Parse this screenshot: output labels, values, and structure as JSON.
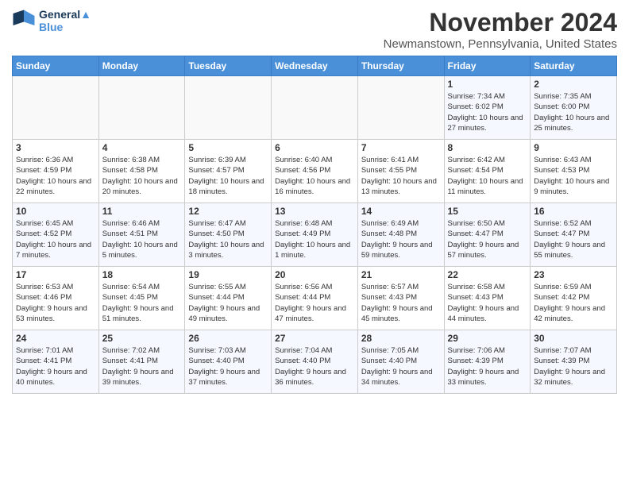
{
  "logo": {
    "line1": "General",
    "line2": "Blue"
  },
  "title": "November 2024",
  "subtitle": "Newmanstown, Pennsylvania, United States",
  "days_of_week": [
    "Sunday",
    "Monday",
    "Tuesday",
    "Wednesday",
    "Thursday",
    "Friday",
    "Saturday"
  ],
  "weeks": [
    [
      {
        "day": "",
        "info": ""
      },
      {
        "day": "",
        "info": ""
      },
      {
        "day": "",
        "info": ""
      },
      {
        "day": "",
        "info": ""
      },
      {
        "day": "",
        "info": ""
      },
      {
        "day": "1",
        "info": "Sunrise: 7:34 AM\nSunset: 6:02 PM\nDaylight: 10 hours and 27 minutes."
      },
      {
        "day": "2",
        "info": "Sunrise: 7:35 AM\nSunset: 6:00 PM\nDaylight: 10 hours and 25 minutes."
      }
    ],
    [
      {
        "day": "3",
        "info": "Sunrise: 6:36 AM\nSunset: 4:59 PM\nDaylight: 10 hours and 22 minutes."
      },
      {
        "day": "4",
        "info": "Sunrise: 6:38 AM\nSunset: 4:58 PM\nDaylight: 10 hours and 20 minutes."
      },
      {
        "day": "5",
        "info": "Sunrise: 6:39 AM\nSunset: 4:57 PM\nDaylight: 10 hours and 18 minutes."
      },
      {
        "day": "6",
        "info": "Sunrise: 6:40 AM\nSunset: 4:56 PM\nDaylight: 10 hours and 16 minutes."
      },
      {
        "day": "7",
        "info": "Sunrise: 6:41 AM\nSunset: 4:55 PM\nDaylight: 10 hours and 13 minutes."
      },
      {
        "day": "8",
        "info": "Sunrise: 6:42 AM\nSunset: 4:54 PM\nDaylight: 10 hours and 11 minutes."
      },
      {
        "day": "9",
        "info": "Sunrise: 6:43 AM\nSunset: 4:53 PM\nDaylight: 10 hours and 9 minutes."
      }
    ],
    [
      {
        "day": "10",
        "info": "Sunrise: 6:45 AM\nSunset: 4:52 PM\nDaylight: 10 hours and 7 minutes."
      },
      {
        "day": "11",
        "info": "Sunrise: 6:46 AM\nSunset: 4:51 PM\nDaylight: 10 hours and 5 minutes."
      },
      {
        "day": "12",
        "info": "Sunrise: 6:47 AM\nSunset: 4:50 PM\nDaylight: 10 hours and 3 minutes."
      },
      {
        "day": "13",
        "info": "Sunrise: 6:48 AM\nSunset: 4:49 PM\nDaylight: 10 hours and 1 minute."
      },
      {
        "day": "14",
        "info": "Sunrise: 6:49 AM\nSunset: 4:48 PM\nDaylight: 9 hours and 59 minutes."
      },
      {
        "day": "15",
        "info": "Sunrise: 6:50 AM\nSunset: 4:47 PM\nDaylight: 9 hours and 57 minutes."
      },
      {
        "day": "16",
        "info": "Sunrise: 6:52 AM\nSunset: 4:47 PM\nDaylight: 9 hours and 55 minutes."
      }
    ],
    [
      {
        "day": "17",
        "info": "Sunrise: 6:53 AM\nSunset: 4:46 PM\nDaylight: 9 hours and 53 minutes."
      },
      {
        "day": "18",
        "info": "Sunrise: 6:54 AM\nSunset: 4:45 PM\nDaylight: 9 hours and 51 minutes."
      },
      {
        "day": "19",
        "info": "Sunrise: 6:55 AM\nSunset: 4:44 PM\nDaylight: 9 hours and 49 minutes."
      },
      {
        "day": "20",
        "info": "Sunrise: 6:56 AM\nSunset: 4:44 PM\nDaylight: 9 hours and 47 minutes."
      },
      {
        "day": "21",
        "info": "Sunrise: 6:57 AM\nSunset: 4:43 PM\nDaylight: 9 hours and 45 minutes."
      },
      {
        "day": "22",
        "info": "Sunrise: 6:58 AM\nSunset: 4:43 PM\nDaylight: 9 hours and 44 minutes."
      },
      {
        "day": "23",
        "info": "Sunrise: 6:59 AM\nSunset: 4:42 PM\nDaylight: 9 hours and 42 minutes."
      }
    ],
    [
      {
        "day": "24",
        "info": "Sunrise: 7:01 AM\nSunset: 4:41 PM\nDaylight: 9 hours and 40 minutes."
      },
      {
        "day": "25",
        "info": "Sunrise: 7:02 AM\nSunset: 4:41 PM\nDaylight: 9 hours and 39 minutes."
      },
      {
        "day": "26",
        "info": "Sunrise: 7:03 AM\nSunset: 4:40 PM\nDaylight: 9 hours and 37 minutes."
      },
      {
        "day": "27",
        "info": "Sunrise: 7:04 AM\nSunset: 4:40 PM\nDaylight: 9 hours and 36 minutes."
      },
      {
        "day": "28",
        "info": "Sunrise: 7:05 AM\nSunset: 4:40 PM\nDaylight: 9 hours and 34 minutes."
      },
      {
        "day": "29",
        "info": "Sunrise: 7:06 AM\nSunset: 4:39 PM\nDaylight: 9 hours and 33 minutes."
      },
      {
        "day": "30",
        "info": "Sunrise: 7:07 AM\nSunset: 4:39 PM\nDaylight: 9 hours and 32 minutes."
      }
    ]
  ]
}
